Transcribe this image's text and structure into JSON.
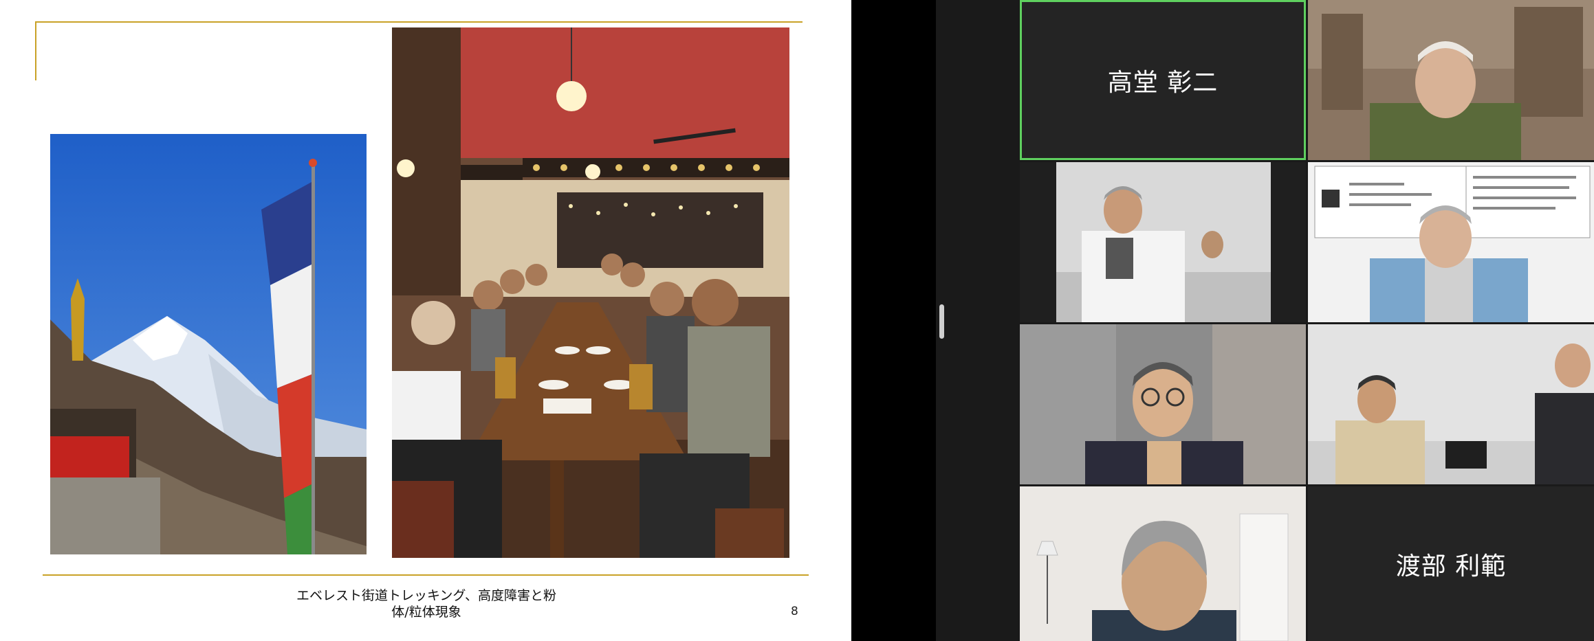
{
  "slide": {
    "caption_line1": "エベレスト街道トレッキング、高度障害と粉",
    "caption_line2": "体/粒体現象",
    "page_number": "8"
  },
  "participants": [
    {
      "display_name": "高堂 彰二",
      "video_on": false,
      "active_speaker": true
    },
    {
      "display_name": "",
      "video_on": true
    },
    {
      "display_name": "",
      "video_on": true
    },
    {
      "display_name": "",
      "video_on": true
    },
    {
      "display_name": "",
      "video_on": true
    },
    {
      "display_name": "",
      "video_on": true
    },
    {
      "display_name": "",
      "video_on": true
    },
    {
      "display_name": "渡部 利範",
      "video_on": false
    }
  ],
  "colors": {
    "accent_gold": "#c9a227",
    "active_speaker": "#5fd05f",
    "tile_bg": "#242424",
    "gallery_bg": "#1a1a1a"
  },
  "icons": {
    "splitter": "drag-handle-icon"
  }
}
